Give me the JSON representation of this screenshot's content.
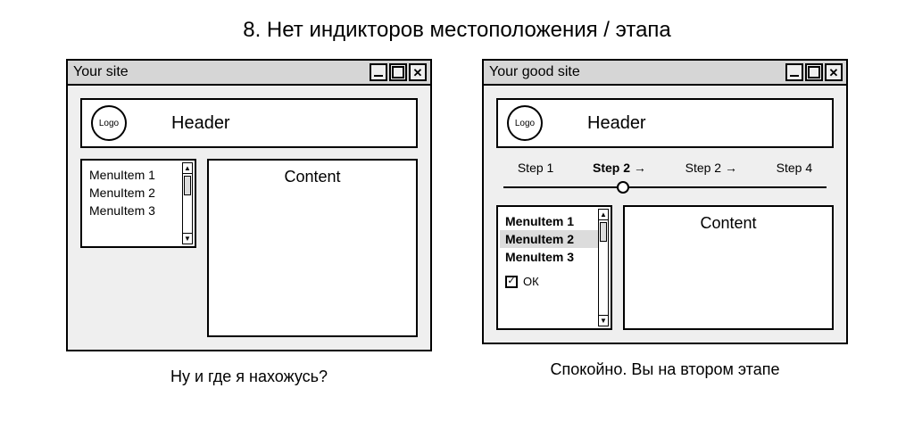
{
  "title": "8. Нет индикторов местоположения / этапа",
  "left": {
    "window_title": "Your site",
    "logo": "Logo",
    "header": "Header",
    "menu": [
      "MenuItem 1",
      "MenuItem 2",
      "MenuItem 3"
    ],
    "content": "Content",
    "caption": "Ну и где я нахожусь?"
  },
  "right": {
    "window_title": "Your good site",
    "logo": "Logo",
    "header": "Header",
    "steps": [
      "Step 1",
      "Step 2 →",
      "Step 2 →",
      "Step 4"
    ],
    "active_step_index": 1,
    "menu": [
      "MenuItem 1",
      "MenuItem 2",
      "MenuItem 3"
    ],
    "active_menu_index": 1,
    "checkbox_label": "ОК",
    "checkbox_checked": true,
    "content": "Content",
    "caption": "Спокойно. Вы на втором этапе"
  }
}
